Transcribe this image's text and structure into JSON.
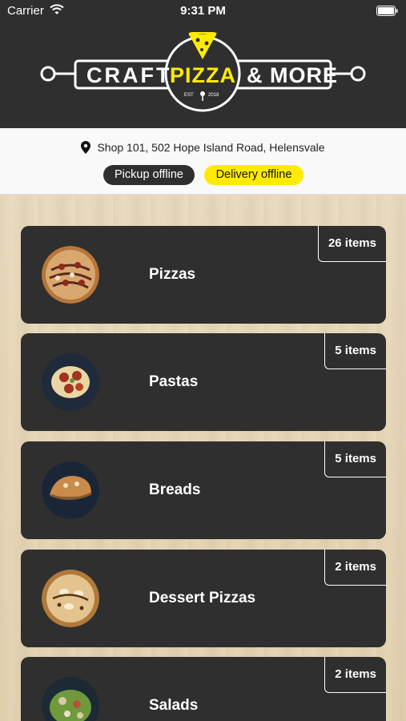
{
  "status_bar": {
    "carrier": "Carrier",
    "time": "9:31 PM"
  },
  "logo": {
    "left_word": "CRAFT",
    "center_word": "PIZZA",
    "right_word": "& MORE",
    "est": "EST",
    "year": "2018"
  },
  "store": {
    "address": "Shop 101, 502 Hope Island Road, Helensvale",
    "pickup_status": "Pickup offline",
    "delivery_status": "Delivery offline"
  },
  "categories": [
    {
      "title": "Pizzas",
      "count": "26 items",
      "thumb": "pizza"
    },
    {
      "title": "Pastas",
      "count": "5 items",
      "thumb": "pasta"
    },
    {
      "title": "Breads",
      "count": "5 items",
      "thumb": "bread"
    },
    {
      "title": "Dessert Pizzas",
      "count": "2 items",
      "thumb": "dessert-pizza"
    },
    {
      "title": "Salads",
      "count": "2 items",
      "thumb": "salad"
    }
  ],
  "colors": {
    "header_bg": "#2f2f2f",
    "accent_yellow": "#ffeb00",
    "card_bg": "#2f2f2f"
  }
}
